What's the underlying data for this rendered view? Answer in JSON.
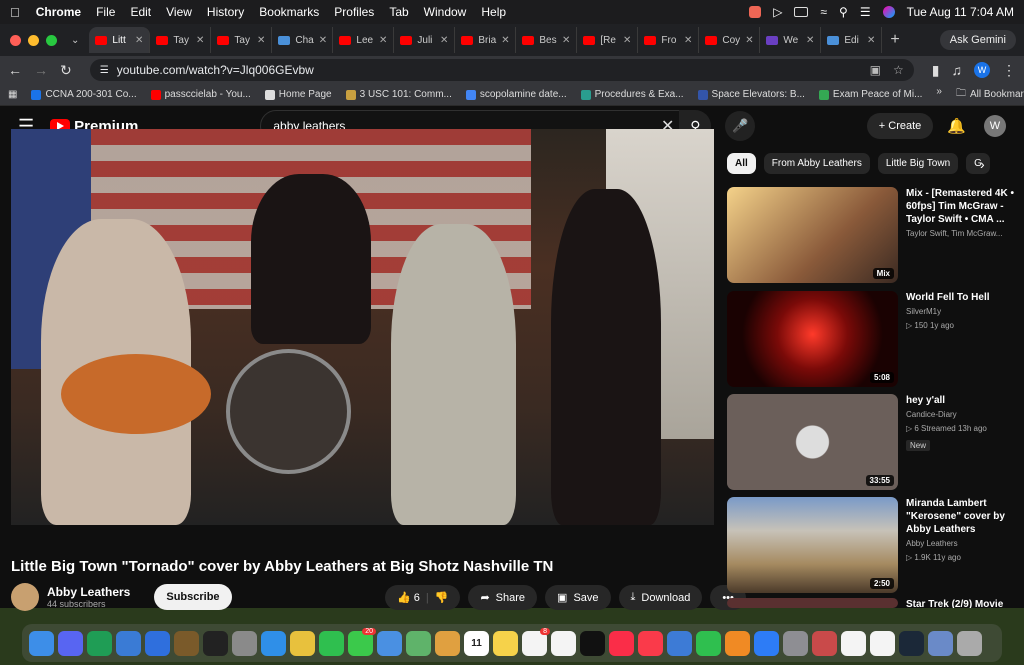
{
  "menubar": {
    "app": "Chrome",
    "items": [
      "File",
      "Edit",
      "View",
      "History",
      "Bookmarks",
      "Profiles",
      "Tab",
      "Window",
      "Help"
    ],
    "clock": "Tue Aug 11  7:04 AM"
  },
  "browser": {
    "tabs": [
      {
        "label": "Litt",
        "color": "#ff0000"
      },
      {
        "label": "Tay",
        "color": "#ff0000"
      },
      {
        "label": "Tay",
        "color": "#ff0000"
      },
      {
        "label": "Cha",
        "color": "#4a90d9"
      },
      {
        "label": "Lee",
        "color": "#ff0000"
      },
      {
        "label": "Juli",
        "color": "#ff0000"
      },
      {
        "label": "Bria",
        "color": "#ff0000"
      },
      {
        "label": "Bes",
        "color": "#ff0000"
      },
      {
        "label": "[Re",
        "color": "#ff0000"
      },
      {
        "label": "Fro",
        "color": "#ff0000"
      },
      {
        "label": "Coy",
        "color": "#ff0000"
      },
      {
        "label": "We",
        "color": "#6a3fc2"
      },
      {
        "label": "Edi",
        "color": "#4a90d9"
      }
    ],
    "gemini_label": "Ask Gemini",
    "url": "youtube.com/watch?v=Jlq006GEvbw",
    "profile_initial": "W",
    "bookmarks": [
      {
        "label": "CCNA 200-301 Co...",
        "color": "#1a73e8"
      },
      {
        "label": "passccielab - You...",
        "color": "#ff0000"
      },
      {
        "label": "Home Page",
        "color": "#dddddd"
      },
      {
        "label": "3 USC 101: Comm...",
        "color": "#c8a040"
      },
      {
        "label": "scopolamine date...",
        "color": "#4285f4"
      },
      {
        "label": "Procedures & Exa...",
        "color": "#2a9d8f"
      },
      {
        "label": "Space Elevators: B...",
        "color": "#3355aa"
      },
      {
        "label": "Exam Peace of Mi...",
        "color": "#34a853"
      }
    ],
    "bookmarks_more": "»",
    "all_bookmarks": "All Bookmarks"
  },
  "youtube": {
    "logo_text": "Premium",
    "search_value": "abby leathers",
    "create_label": "Create",
    "avatar_initial": "W",
    "video": {
      "title": "Little Big Town \"Tornado\" cover by Abby Leathers at Big Shotz Nashville TN",
      "channel": "Abby Leathers",
      "subscribers": "44 subscribers",
      "subscribe_label": "Subscribe",
      "likes": "6",
      "share_label": "Share",
      "save_label": "Save",
      "download_label": "Download",
      "more_label": "•••"
    },
    "chips": [
      "All",
      "From Abby Leathers",
      "Little Big Town",
      "G"
    ],
    "recommendations": [
      {
        "title": "Mix - [Remastered 4K • 60fps] Tim McGraw - Taylor Swift • CMA ...",
        "line1": "Taylor Swift, Tim McGraw...",
        "line2": "",
        "badge": "Mix",
        "new": ""
      },
      {
        "title": "World Fell To Hell",
        "line1": "SilverM1y",
        "line2": "▷ 150   1y ago",
        "badge": "5:08",
        "new": ""
      },
      {
        "title": "hey y'all",
        "line1": "Candice-Diary",
        "line2": "▷ 6   Streamed 13h ago",
        "badge": "33:55",
        "new": "New"
      },
      {
        "title": "Miranda Lambert \"Kerosene\" cover by Abby Leathers",
        "line1": "Abby Leathers",
        "line2": "▷ 1.9K   11y ago",
        "badge": "2:50",
        "new": ""
      },
      {
        "title": "Star Trek (2/9) Movie",
        "line1": "",
        "line2": "",
        "badge": "",
        "new": ""
      }
    ]
  },
  "dock": {
    "apps": [
      "finder",
      "discord",
      "numbers-app",
      "xcode",
      "safari-alt",
      "world-of-warcraft",
      "x-app",
      "launchpad",
      "safari",
      "chrome",
      "facetime",
      "messages",
      "mail",
      "maps",
      "photos",
      "calendar",
      "notes",
      "reminders",
      "freeform",
      "appletv",
      "music",
      "news",
      "keynote",
      "numbers",
      "pages",
      "appstore",
      "settings",
      "iphone-mirroring",
      "textedit",
      "clock",
      "steam",
      "preview",
      "trash"
    ],
    "messages_badge": "20",
    "reminders_badge": "8",
    "calendar_day": "11"
  }
}
